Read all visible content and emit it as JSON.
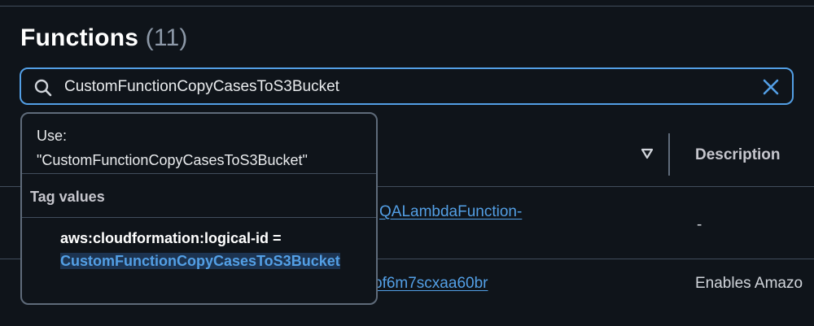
{
  "header": {
    "title": "Functions",
    "count": "(11)"
  },
  "search": {
    "value": "CustomFunctionCopyCasesToS3Bucket"
  },
  "table": {
    "columns": {
      "description": "Description"
    },
    "rows": [
      {
        "name_tail": "QALambdaFunction-",
        "description": "-"
      },
      {
        "name_tail": "of6m7scxaa60br",
        "description": "Enables Amazo"
      }
    ]
  },
  "dropdown": {
    "use_label": "Use:",
    "use_value": "\"CustomFunctionCopyCasesToS3Bucket\"",
    "group_label": "Tag values",
    "option_key": "aws:cloudformation:logical-id =",
    "option_value": "CustomFunctionCopyCasesToS3Bucket"
  },
  "colors": {
    "accent": "#539fe5",
    "background": "#0f141a",
    "border": "#5f6b7a"
  }
}
